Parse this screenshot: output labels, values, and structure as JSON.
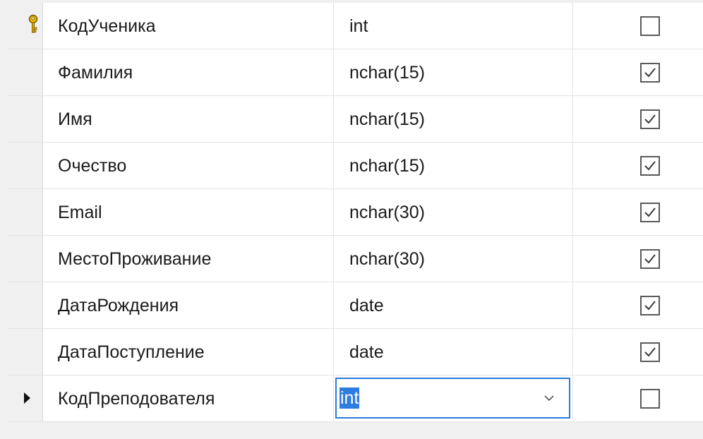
{
  "columns": [
    {
      "name": "КодУченика",
      "type": "int",
      "allow_nulls": false,
      "primary_key": true
    },
    {
      "name": "Фамилия",
      "type": "nchar(15)",
      "allow_nulls": true
    },
    {
      "name": "Имя",
      "type": "nchar(15)",
      "allow_nulls": true
    },
    {
      "name": "Очество",
      "type": "nchar(15)",
      "allow_nulls": true
    },
    {
      "name": "Email",
      "type": "nchar(30)",
      "allow_nulls": true
    },
    {
      "name": "МестоПроживание",
      "type": "nchar(30)",
      "allow_nulls": true
    },
    {
      "name": "ДатаРождения",
      "type": "date",
      "allow_nulls": true
    },
    {
      "name": "ДатаПоступление",
      "type": "date",
      "allow_nulls": true
    },
    {
      "name": "КодПреподователя",
      "type": "int",
      "allow_nulls": false,
      "current_row": true,
      "editing": true
    }
  ],
  "colors": {
    "key_icon": "#e8b400",
    "selection": "#2d7de0",
    "editor_border": "#2b7bd8"
  }
}
